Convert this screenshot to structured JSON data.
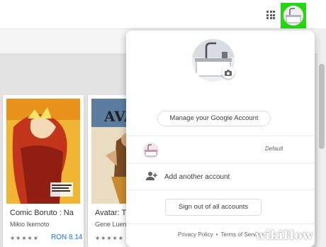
{
  "account_menu": {
    "manage_label": "Manage your Google Account",
    "default_label": "Default",
    "add_account_label": "Add another account",
    "sign_out_label": "Sign out of all accounts",
    "footer": {
      "privacy": "Privacy Policy",
      "separator": "•",
      "terms": "Terms of Service"
    }
  },
  "books": [
    {
      "title": "Comic Boruto : Na",
      "author": "Mikio Ikemoto",
      "rating_stars": "★★★★★",
      "price": "RON 8.14",
      "cover": "boruto-cover"
    },
    {
      "title": "Avatar: Th",
      "author": "Gene Luen Y",
      "rating_stars": "★★★★★",
      "price": "",
      "cover": "avatar-cover"
    }
  ],
  "icons": {
    "apps": "apps-grid-icon",
    "camera": "camera-icon",
    "add_person": "add-person-icon"
  },
  "colors": {
    "highlight": "#26d612",
    "link": "#1a73e8",
    "text": "#3c4043"
  },
  "watermark": {
    "wiki": "wiki",
    "how": "How"
  }
}
